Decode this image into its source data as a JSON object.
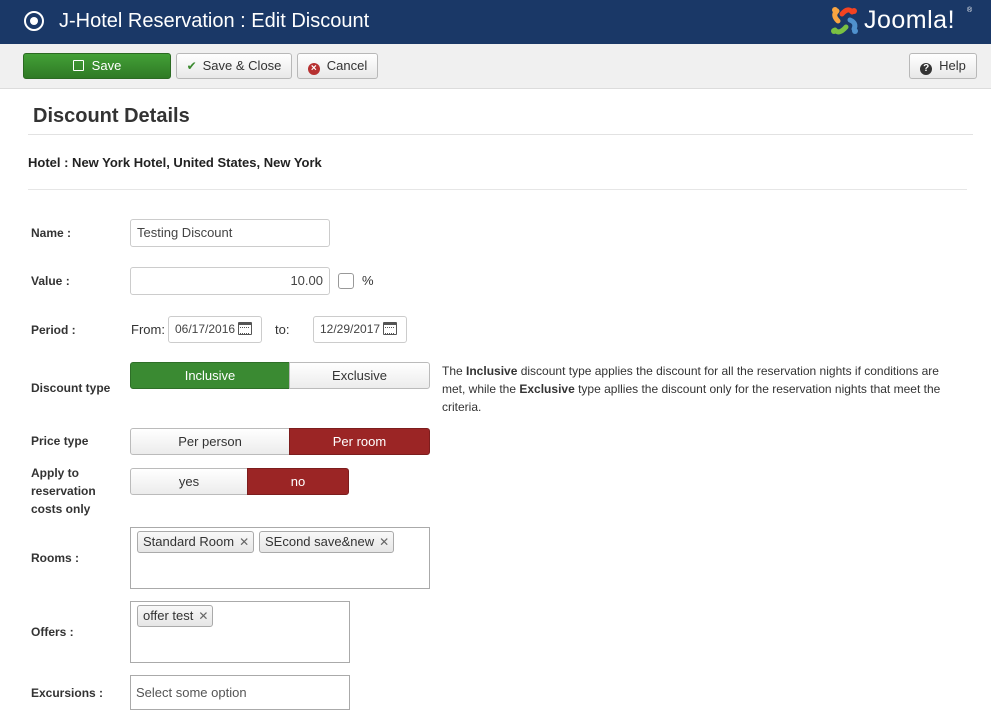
{
  "header": {
    "title": "J-Hotel Reservation : Edit Discount",
    "brand": "Joomla!",
    "brand_sup": "®"
  },
  "toolbar": {
    "save": "Save",
    "save_close": "Save & Close",
    "cancel": "Cancel",
    "help": "Help"
  },
  "section": {
    "title": "Discount Details",
    "hotel_line": "Hotel : New York Hotel, United States, New York"
  },
  "form": {
    "name_label": "Name :",
    "name_value": "Testing Discount",
    "value_label": "Value :",
    "value_value": "10.00",
    "percent_label": "%",
    "period_label": "Period :",
    "from_label": "From:",
    "from_value": "06/17/2016",
    "to_label": "to:",
    "to_value": "12/29/2017",
    "discount_type_label": "Discount type",
    "discount_type_options": [
      "Inclusive",
      "Exclusive"
    ],
    "discount_type_selected": "Inclusive",
    "discount_help": {
      "p1": "The ",
      "b1": "Inclusive",
      "p2": " discount type applies the discount for all the reservation nights if conditions are met, while the ",
      "b2": "Exclusive",
      "p3": " type apllies the discount only for the reservation nights that meet the criteria."
    },
    "price_type_label": "Price type",
    "price_type_options": [
      "Per person",
      "Per room"
    ],
    "price_type_selected": "Per room",
    "apply_label_lines": [
      "Apply to",
      "reservation",
      "costs only"
    ],
    "apply_options": [
      "yes",
      "no"
    ],
    "apply_selected": "no",
    "rooms_label": "Rooms :",
    "rooms": [
      "Standard Room",
      "SEcond save&new"
    ],
    "offers_label": "Offers :",
    "offers": [
      "offer test"
    ],
    "excursions_label": "Excursions :",
    "excursions_placeholder": "Select some option"
  },
  "colors": {
    "header_bg": "#1a3867",
    "save_green": "#3b8a2f",
    "selected_red": "#9b2525"
  }
}
